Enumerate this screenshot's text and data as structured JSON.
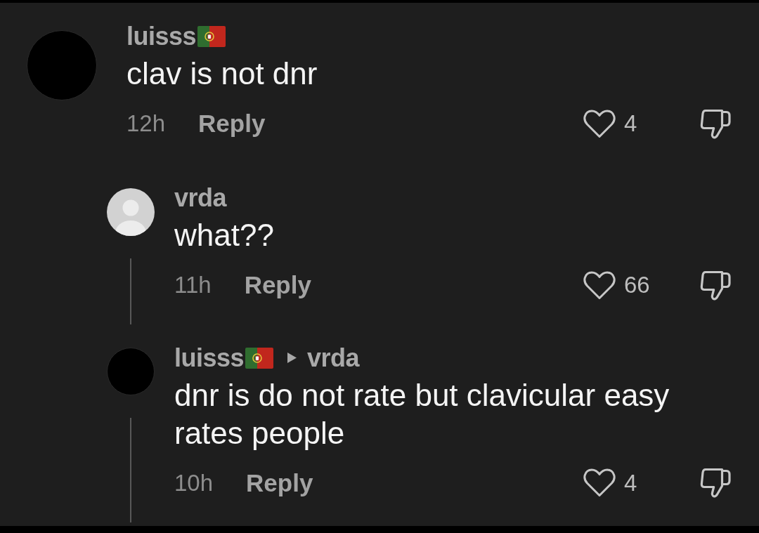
{
  "comments": [
    {
      "author": "luisss",
      "flag": true,
      "avatar": {
        "kind": "blank"
      },
      "text": "clav is not dnr",
      "time": "12h",
      "reply_label": "Reply",
      "likes": "4",
      "liked": false,
      "disliked": false,
      "replies": [
        {
          "author": "vrda",
          "avatar": {
            "kind": "default"
          },
          "text": "what??",
          "time": "11h",
          "reply_label": "Reply",
          "likes": "66",
          "liked": false,
          "disliked": false
        },
        {
          "author": "luisss",
          "flag": true,
          "reply_to": "vrda",
          "avatar": {
            "kind": "blank"
          },
          "text": "dnr is do not rate but clavicular easy rates people",
          "time": "10h",
          "reply_label": "Reply",
          "likes": "4",
          "liked": false,
          "disliked": false
        }
      ]
    }
  ]
}
